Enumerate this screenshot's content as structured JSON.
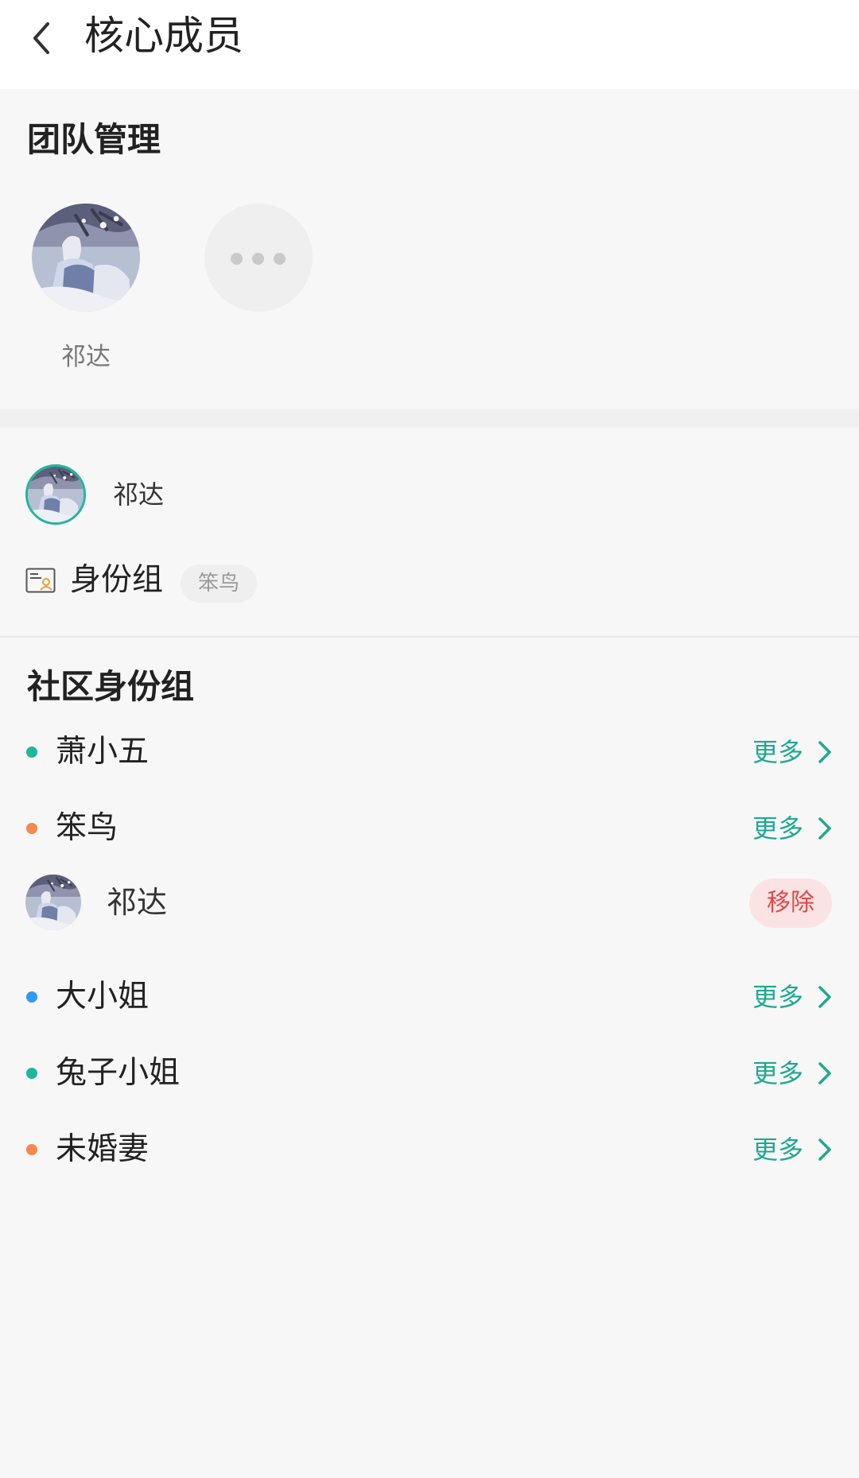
{
  "header": {
    "title": "核心成员",
    "back_icon": "chevron-left-icon"
  },
  "team": {
    "title": "团队管理",
    "members": [
      {
        "name": "祁达",
        "avatar": "anime-avatar"
      }
    ],
    "more_icon": "more-dots-icon"
  },
  "member": {
    "name": "祁达",
    "identity_label": "身份组",
    "identity_tag": "笨鸟",
    "identity_icon": "id-card-icon"
  },
  "community": {
    "title": "社区身份组",
    "more_label": "更多",
    "roles": [
      {
        "name": "萧小五",
        "color": "#1fb6a0"
      },
      {
        "name": "笨鸟",
        "color": "#f4894b"
      },
      {
        "name": "大小姐",
        "color": "#2f9bf0"
      },
      {
        "name": "兔子小姐",
        "color": "#1fb6a0"
      },
      {
        "name": "未婚妻",
        "color": "#f4894b"
      }
    ],
    "assigned": {
      "name": "祁达",
      "remove_label": "移除"
    }
  },
  "colors": {
    "accent": "#1fa890",
    "remove_bg": "#fbe3e3",
    "remove_text": "#e0484b"
  }
}
